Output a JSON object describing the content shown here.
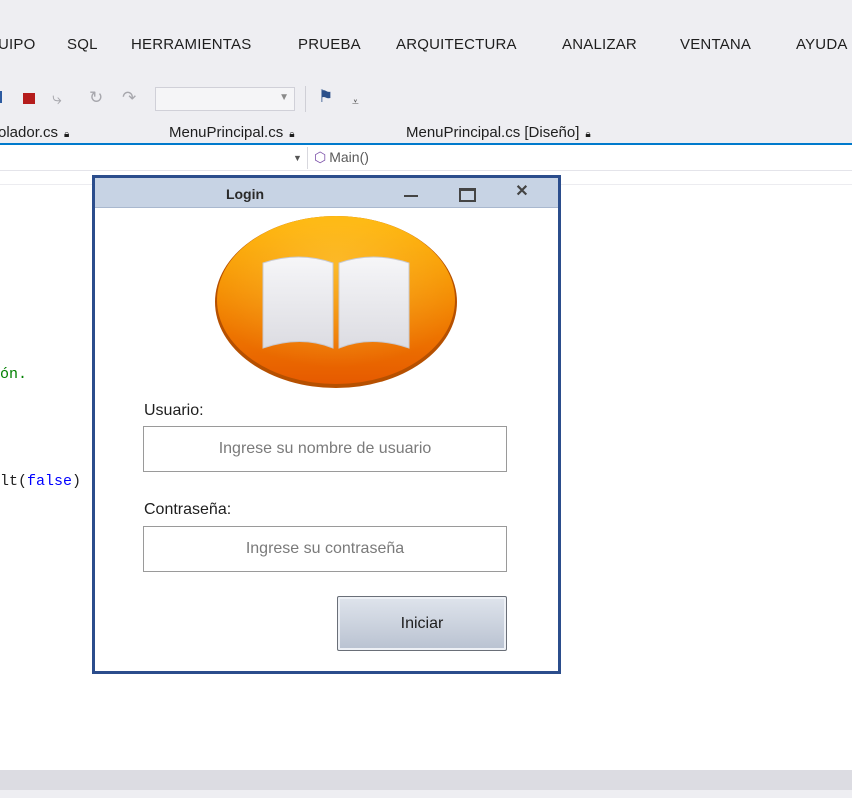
{
  "ide": {
    "menu": [
      "UIPO",
      "SQL",
      "HERRAMIENTAS",
      "PRUEBA",
      "ARQUITECTURA",
      "ANALIZAR",
      "VENTANA",
      "AYUDA"
    ],
    "tabs": [
      "olador.cs",
      "MenuPrincipal.cs",
      "MenuPrincipal.cs [Diseño]"
    ],
    "nav_method": "Main()",
    "code_comment": "ón.",
    "code_line_prefix": "lt(",
    "code_keyword": "false",
    "code_line_suffix": ")",
    "icons": {
      "toolbar": [
        "stop-icon",
        "step-into-icon",
        "step-over-icon",
        "step-out-icon",
        "find-icon",
        "overflow-icon"
      ],
      "tab_lock": "lock-icon",
      "method": "method-icon"
    }
  },
  "login_window": {
    "title": "Login",
    "logo": "book-logo",
    "user_label": "Usuario:",
    "user_placeholder": "Ingrese su nombre de usuario",
    "password_label": "Contraseña:",
    "password_placeholder": "Ingrese su contraseña",
    "submit_label": "Iniciar",
    "colors": {
      "frame": "#2b4d8c",
      "titlebar": "#c7d3e4",
      "logo_top": "#ffb300",
      "logo_bottom": "#e65a00"
    }
  }
}
